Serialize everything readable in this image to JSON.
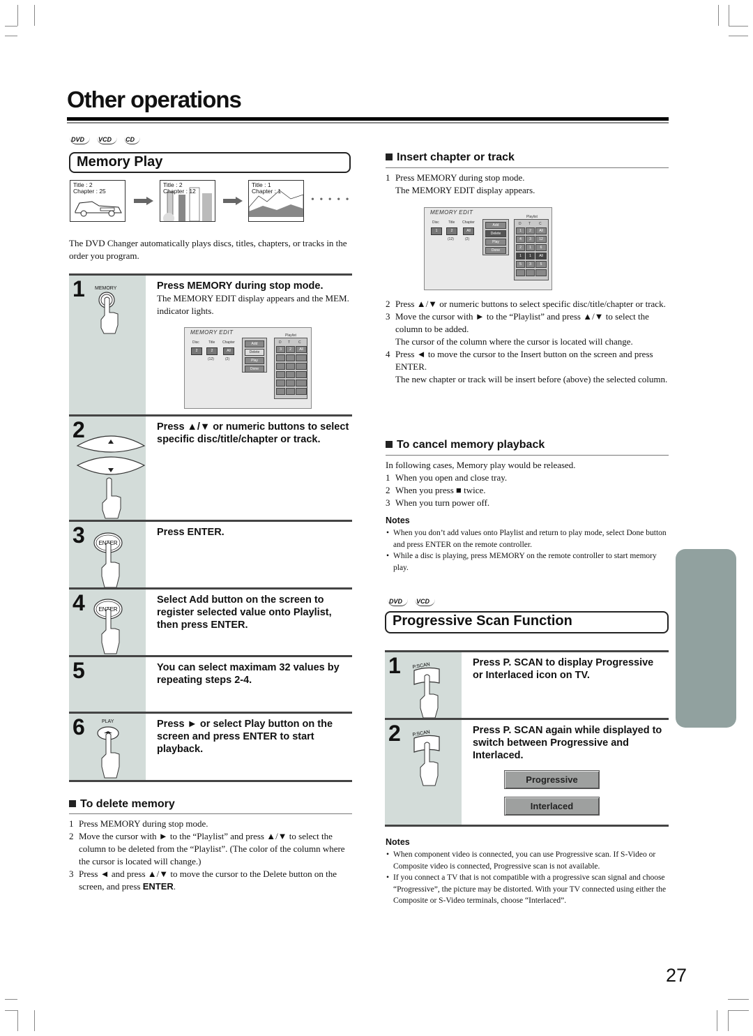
{
  "page": {
    "title": "Other operations",
    "page_number": "27"
  },
  "memory_play": {
    "disc_logos": [
      "DVD",
      "VCD",
      "CD"
    ],
    "heading": "Memory Play",
    "thumbnails": [
      {
        "line1": "Title : 2",
        "line2": "Chapter : 25"
      },
      {
        "line1": "Title : 2",
        "line2": "Chapter : 12"
      },
      {
        "line1": "Title : 1",
        "line2": "Chapter : 1"
      }
    ],
    "ellipsis": "• • • • •",
    "intro": "The DVD Changer automatically plays discs, titles, chapters, or tracks in the order you program.",
    "steps": [
      {
        "num": "1",
        "button_label": "MEMORY",
        "text": "Press MEMORY during stop mode.",
        "sub": "The MEMORY EDIT display appears and the MEM. indicator lights."
      },
      {
        "num": "2",
        "button_label": "▲ / ▼",
        "text": "Press ▲/▼ or numeric buttons to select specific disc/title/chapter or track."
      },
      {
        "num": "3",
        "button_label": "ENTER",
        "text": "Press ENTER."
      },
      {
        "num": "4",
        "button_label": "ENTER",
        "text": "Select Add button on the screen to register selected value onto Playlist, then press ENTER."
      },
      {
        "num": "5",
        "text": "You can select maximam 32 values by repeating steps 2-4."
      },
      {
        "num": "6",
        "button_label": "PLAY",
        "text": "Press ► or select Play button on the screen and press ENTER to start playback."
      }
    ]
  },
  "memory_edit_screen_1": {
    "title": "MEMORY EDIT",
    "labels": {
      "disc": "Disc",
      "title": "Title",
      "chapter": "Chapter",
      "playlist": "Playlist"
    },
    "values": {
      "disc": "2",
      "title": "2",
      "chapter": "All",
      "title_count": "(12)",
      "chapter_count": "(2)"
    },
    "buttons": [
      "Add",
      "Delete",
      "Play",
      "Done"
    ],
    "columns": [
      "D",
      "T",
      "C"
    ],
    "rows": [
      [
        "3",
        "2",
        "All"
      ],
      [
        "",
        "",
        ""
      ],
      [
        "",
        "",
        ""
      ],
      [
        "",
        "",
        ""
      ],
      [
        "",
        "",
        ""
      ],
      [
        "",
        "",
        ""
      ]
    ]
  },
  "memory_edit_screen_2": {
    "title": "MEMORY EDIT",
    "labels": {
      "disc": "Disc",
      "title": "Title",
      "chapter": "Chapter",
      "playlist": "Playlist"
    },
    "values": {
      "disc": "1",
      "title": "2",
      "chapter": "All",
      "title_count": "(12)",
      "chapter_count": "(2)"
    },
    "buttons": [
      "Add",
      "Delete",
      "Play",
      "Done"
    ],
    "columns": [
      "D",
      "T",
      "C"
    ],
    "rows": [
      [
        "1",
        "2",
        "All"
      ],
      [
        "4",
        "3",
        "12"
      ],
      [
        "2",
        "1",
        "6"
      ],
      [
        "1",
        "1",
        "All"
      ],
      [
        "5",
        "3",
        "5"
      ],
      [
        "",
        "",
        ""
      ]
    ]
  },
  "delete_memory": {
    "heading": "To delete memory",
    "items": [
      {
        "n": "1",
        "text": "Press MEMORY during stop mode."
      },
      {
        "n": "2",
        "text": "Move the cursor with ► to the “Playlist” and press ▲/▼ to select the column to be deleted from the “Playlist”. (The color of the column where the cursor is located will change.)"
      },
      {
        "n": "3",
        "text": "Press ◄ and press ▲/▼ to move the cursor to the Delete button on the screen, and press ",
        "bold_tail": "ENTER",
        "tail": "."
      }
    ]
  },
  "insert_chapter": {
    "heading": "Insert chapter or track",
    "item1": {
      "n": "1",
      "text": "Press MEMORY during stop mode.",
      "sub": "The MEMORY EDIT display appears."
    },
    "items": [
      {
        "n": "2",
        "text": "Press ▲/▼ or numeric buttons to select specific disc/title/chapter or track."
      },
      {
        "n": "3",
        "text": "Move the cursor with ► to the “Playlist” and press ▲/▼ to select the column to be added.",
        "sub": "The cursor of the column where the cursor is located will change."
      },
      {
        "n": "4",
        "text": "Press ◄ to move the cursor to the Insert button on the screen and press ENTER.",
        "sub": "The new chapter or track will be insert before (above) the selected column."
      }
    ]
  },
  "cancel_memory": {
    "heading": "To cancel memory playback",
    "intro": "In following cases, Memory play would be released.",
    "items": [
      {
        "n": "1",
        "text": "When you open and close tray."
      },
      {
        "n": "2",
        "text": "When you press ■ twice."
      },
      {
        "n": "3",
        "text": "When you turn power off."
      }
    ],
    "notes_heading": "Notes",
    "notes": [
      "When you don’t add values onto Playlist and return to play mode, select Done button and press ENTER on the remote controller.",
      "While a disc is playing, press MEMORY on the remote controller to start memory play."
    ]
  },
  "progressive": {
    "disc_logos": [
      "DVD",
      "VCD"
    ],
    "heading": "Progressive Scan Function",
    "steps": [
      {
        "num": "1",
        "button_label": "P.SCAN",
        "text": "Press P. SCAN to display Progressive or Interlaced icon on TV."
      },
      {
        "num": "2",
        "button_label": "P.SCAN",
        "text": "Press P. SCAN again while displayed to switch between Progressive and Interlaced."
      }
    ],
    "osd": [
      "Progressive",
      "Interlaced"
    ],
    "notes_heading": "Notes",
    "notes": [
      "When component video is connected, you can use Progressive scan. If S-Video or Composite video is connected, Progressive scan is not available.",
      "If you connect a TV that is not compatible with a progressive scan signal and choose “Progressive”, the picture may be distorted. With your TV connected using either the Composite or S-Video terminals, choose “Interlaced”."
    ]
  },
  "colors": {
    "step_panel": "#d3dcd9",
    "side_tab": "#91a19f",
    "rule": "#444444"
  }
}
